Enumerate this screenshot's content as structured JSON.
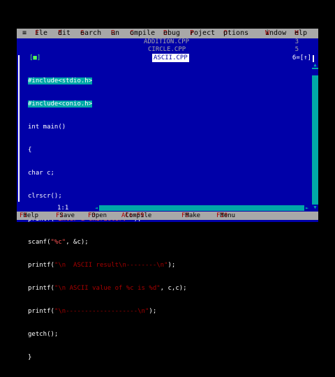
{
  "menu": {
    "system": "≡",
    "items": [
      {
        "hot": "F",
        "rest": "ile"
      },
      {
        "hot": "E",
        "rest": "dit"
      },
      {
        "hot": "S",
        "rest": "earch"
      },
      {
        "hot": "R",
        "rest": "un"
      },
      {
        "hot": "C",
        "rest": "ompile"
      },
      {
        "hot": "D",
        "rest": "ebug"
      },
      {
        "hot": "P",
        "rest": "roject"
      },
      {
        "hot": "O",
        "rest": "ptions"
      },
      {
        "hot": "W",
        "rest": "indow"
      },
      {
        "hot": "H",
        "rest": "elp"
      }
    ]
  },
  "windows": [
    {
      "title": "ADDITION.CPP",
      "number": "3"
    },
    {
      "title": "CIRCLE.CPP",
      "number": "5"
    }
  ],
  "active_window": {
    "close_box": "[■]",
    "title": "ASCII.CPP",
    "number_zoom": "6=[↑]"
  },
  "code": {
    "l1": "#include<stdio.h>",
    "l2": "#include<conio.h>",
    "l3": "int main()",
    "l4": "{",
    "l5": "char c;",
    "l6": "clrscr();",
    "l7a": "printf(",
    "l7b": "\"Enter a character: \"",
    "l7c": ");",
    "l8a": "scanf(",
    "l8b": "\"%c\"",
    "l8c": ", &c);",
    "l9a": "printf(",
    "l9b": "\"\\n  ASCII result\\n--------\\n\"",
    "l9c": ");",
    "l10a": "printf(",
    "l10b": "\"\\n ASCII value of %c is %d\"",
    "l10c": ", c,c);",
    "l11a": "printf(",
    "l11b": "\"\\n-------------------\\n\"",
    "l11c": ");",
    "l12": "getch();",
    "l13": "}"
  },
  "cursor_position": "1:1",
  "status": [
    {
      "key": "F1",
      "label": " Help"
    },
    {
      "key": "F2",
      "label": " Save"
    },
    {
      "key": "F3",
      "label": " Open"
    },
    {
      "key": "Alt-F9",
      "label": " Compile"
    },
    {
      "key": "F9",
      "label": " Make"
    },
    {
      "key": "F10",
      "label": " Menu"
    }
  ],
  "colors": {
    "editor_bg": "#0000a8",
    "menu_bg": "#a8a8a8",
    "hotkey": "#a80000",
    "selection": "#00a8a8",
    "string": "#ff5555"
  }
}
